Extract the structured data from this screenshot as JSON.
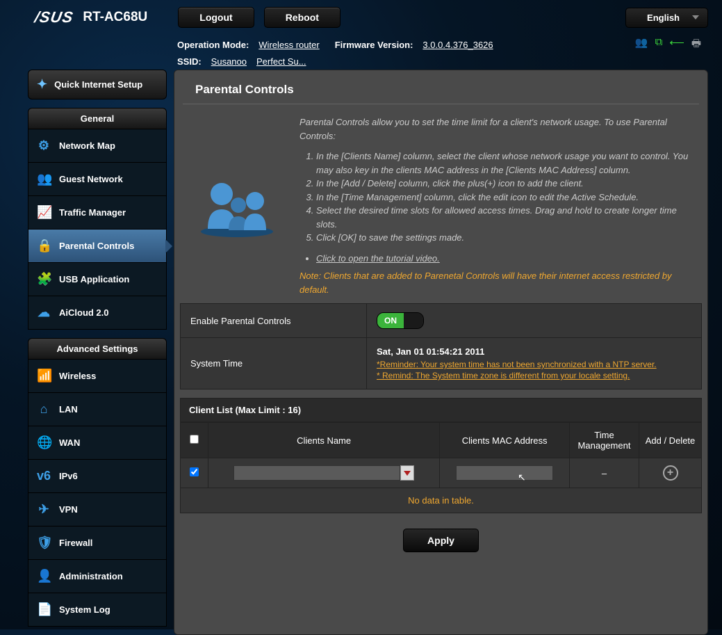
{
  "header": {
    "logo": "/SUS",
    "model": "RT-AC68U",
    "logout": "Logout",
    "reboot": "Reboot",
    "language": "English"
  },
  "info": {
    "op_mode_label": "Operation Mode:",
    "op_mode": "Wireless router",
    "fw_label": "Firmware Version:",
    "fw": "3.0.0.4.376_3626",
    "ssid_label": "SSID:",
    "ssid1": "Susanoo",
    "ssid2": "Perfect Su..."
  },
  "sidebar": {
    "qis": "Quick Internet Setup",
    "general_title": "General",
    "general": [
      {
        "label": "Network Map",
        "icon": "⚙"
      },
      {
        "label": "Guest Network",
        "icon": "👥"
      },
      {
        "label": "Traffic Manager",
        "icon": "📈"
      },
      {
        "label": "Parental Controls",
        "icon": "🔒"
      },
      {
        "label": "USB Application",
        "icon": "🧩"
      },
      {
        "label": "AiCloud 2.0",
        "icon": "☁"
      }
    ],
    "advanced_title": "Advanced Settings",
    "advanced": [
      {
        "label": "Wireless",
        "icon": "📶"
      },
      {
        "label": "LAN",
        "icon": "⌂"
      },
      {
        "label": "WAN",
        "icon": "🌐"
      },
      {
        "label": "IPv6",
        "icon": "v6"
      },
      {
        "label": "VPN",
        "icon": "✈"
      },
      {
        "label": "Firewall",
        "icon": "🛡"
      },
      {
        "label": "Administration",
        "icon": "👤"
      },
      {
        "label": "System Log",
        "icon": "📄"
      }
    ]
  },
  "page": {
    "title": "Parental Controls",
    "intro": "Parental Controls allow you to set the time limit for a client's network usage. To use Parental Controls:",
    "steps": [
      "In the [Clients Name] column, select the client whose network usage you want to control. You may also key in the clients MAC address in the [Clients MAC Address] column.",
      "In the [Add / Delete] column, click the plus(+) icon to add the client.",
      "In the [Time Management] column, click the edit icon to edit the Active Schedule.",
      "Select the desired time slots for allowed access times. Drag and hold to create longer time slots.",
      "Click [OK] to save the settings made."
    ],
    "tutorial": "Click to open the tutorial video.",
    "note": "Note: Clients that are added to Parenetal Controls will have their internet access restricted by default.",
    "enable_label": "Enable Parental Controls",
    "toggle_on": "ON",
    "systime_label": "System Time",
    "systime": "Sat, Jan 01 01:54:21 2011",
    "reminder1": "*Reminder: Your system time has not been synchronized with a NTP server.",
    "reminder2": "* Remind: The System time zone is different from your locale setting.",
    "client_list_title": "Client List (Max Limit : 16)",
    "columns": {
      "name": "Clients Name",
      "mac": "Clients MAC Address",
      "time": "Time Management",
      "add": "Add / Delete"
    },
    "time_mgmt_placeholder": "–",
    "no_data": "No data in table.",
    "apply": "Apply"
  }
}
